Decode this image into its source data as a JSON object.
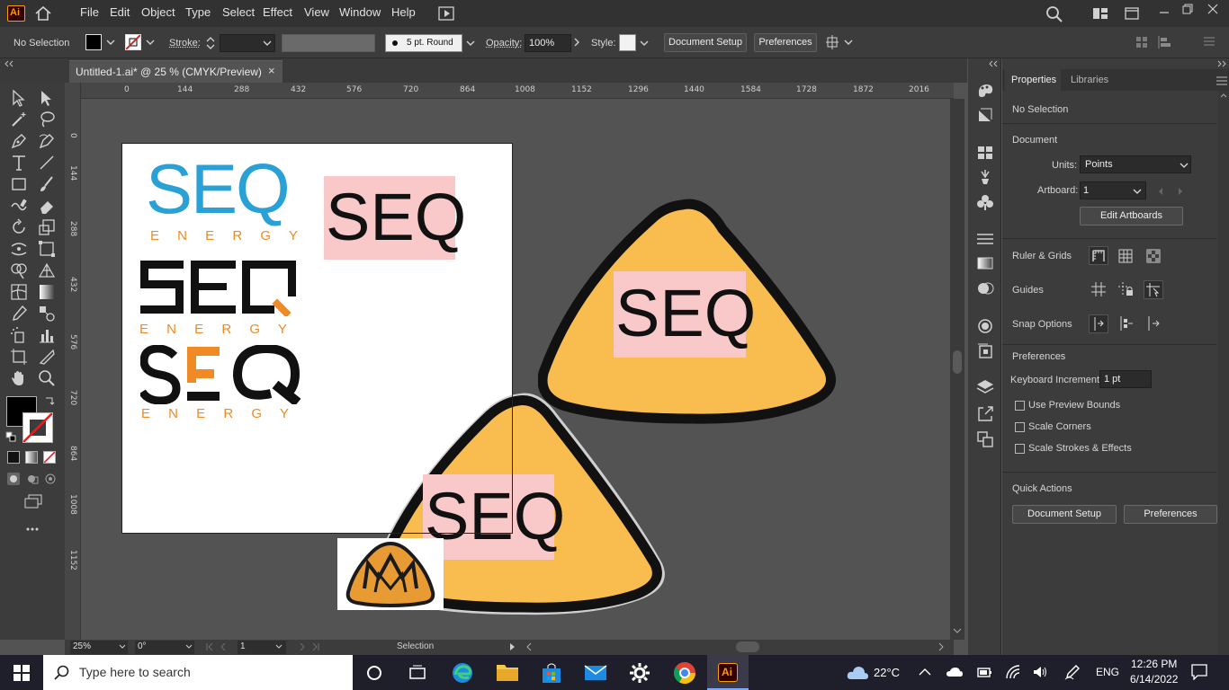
{
  "app": {
    "logo": "Ai"
  },
  "menu": [
    "File",
    "Edit",
    "Object",
    "Type",
    "Select",
    "Effect",
    "View",
    "Window",
    "Help"
  ],
  "control_bar": {
    "selection_state": "No Selection",
    "stroke_label": "Stroke:",
    "brush": "5 pt. Round",
    "opacity_label": "Opacity:",
    "opacity_value": "100%",
    "style_label": "Style:",
    "document_setup": "Document Setup",
    "preferences": "Preferences"
  },
  "document_tab": {
    "title": "Untitled-1.ai* @ 25 % (CMYK/Preview)",
    "close": "×"
  },
  "ruler": {
    "top": [
      "0",
      "144",
      "288",
      "432",
      "576",
      "720",
      "864",
      "1008",
      "1152",
      "1296",
      "1440",
      "1584",
      "1728",
      "1872",
      "2016"
    ],
    "left": [
      "0",
      "144",
      "288",
      "432",
      "576",
      "720",
      "864",
      "1008",
      "1152"
    ]
  },
  "artwork": {
    "seq": "SEQ",
    "energy": "E N E R G Y",
    "colors": {
      "blue": "#2aa1d6",
      "orange": "#f08a24",
      "pink": "#f9c9c9",
      "yellow": "#f9bc4f",
      "black": "#111111"
    }
  },
  "status_bar": {
    "zoom": "25%",
    "rotation": "0°",
    "artboard": "1",
    "tool": "Selection"
  },
  "panel": {
    "tabs": [
      "Properties",
      "Libraries"
    ],
    "selection": "No Selection",
    "document_heading": "Document",
    "units_label": "Units:",
    "units_value": "Points",
    "artboard_label": "Artboard:",
    "artboard_value": "1",
    "edit_artboards": "Edit Artboards",
    "ruler_grids": "Ruler & Grids",
    "guides": "Guides",
    "snap_options": "Snap Options",
    "preferences_heading": "Preferences",
    "keyboard_increment_label": "Keyboard Increment:",
    "keyboard_increment_value": "1 pt",
    "checkboxes": [
      "Use Preview Bounds",
      "Scale Corners",
      "Scale Strokes & Effects"
    ],
    "quick_actions": "Quick Actions",
    "document_setup": "Document Setup",
    "preferences": "Preferences"
  },
  "taskbar": {
    "search_placeholder": "Type here to search",
    "weather": "22°C",
    "language": "ENG",
    "time": "12:26 PM",
    "date": "6/14/2022"
  }
}
